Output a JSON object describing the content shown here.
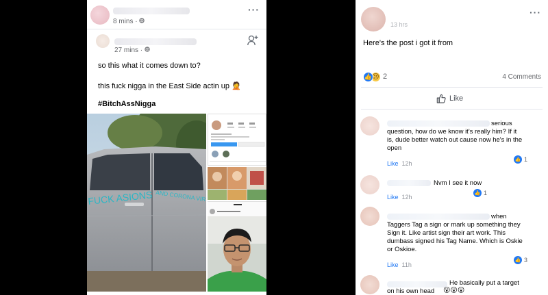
{
  "left_post": {
    "outer": {
      "meta_time": "8 mins",
      "meta_audience": "public-globe-icon"
    },
    "inner": {
      "meta_time": "27 mins",
      "meta_audience": "public-globe-icon",
      "line1": "so this what it comes down to?",
      "line2": "this fuck nigga in the East Side actin up 🤦",
      "hashtag": "#BitchAssNigga",
      "car_graffiti_left": "FUCK ASIONS",
      "car_graffiti_right": "AND CORONA VIRUS"
    }
  },
  "right_post": {
    "meta_time": "13 hrs",
    "text": "Here's the post i got it from",
    "reaction_count": "2",
    "comment_count": "4 Comments",
    "like_label": "Like",
    "comments": [
      {
        "text": "serious question, how do we know it's really him? If it is, dude better watch out cause now he's in the open",
        "like_label": "Like",
        "time": "12h",
        "reactions": "1"
      },
      {
        "text": "Nvm I see it now",
        "like_label": "Like",
        "time": "12h",
        "reactions": "1"
      },
      {
        "text": "when Taggers Tag a sign or mark up something they Sign it. Like artist sign their art work. This dumbass signed his Tag Name. Which is Oskie or Oskioe.",
        "like_label": "Like",
        "time": "11h",
        "reactions": "3"
      },
      {
        "text": "He basically put a target on his own head",
        "emoji": "😮😮😮"
      }
    ]
  },
  "colors": {
    "facebook_blue": "#2078f4",
    "text": "#050505",
    "meta": "#65676b"
  }
}
